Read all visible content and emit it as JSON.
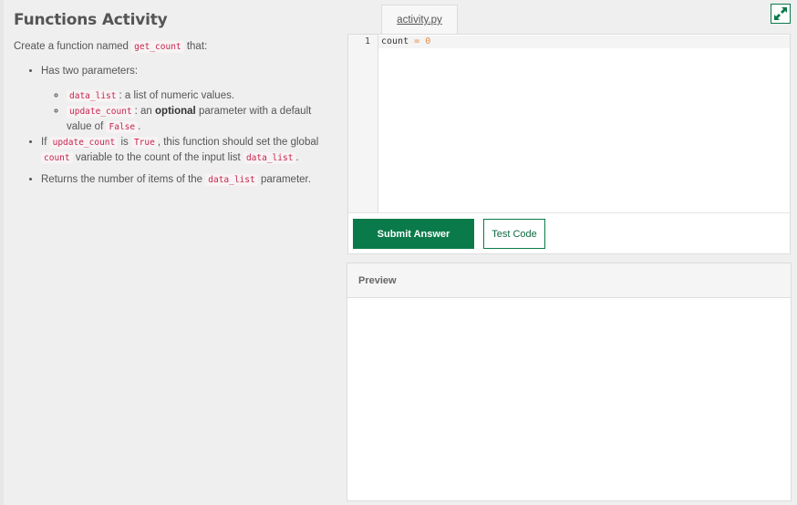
{
  "instructions": {
    "title": "Functions Activity",
    "intro_pre": "Create a function named",
    "intro_code": "get_count",
    "intro_post": "that:",
    "bullet1": {
      "text": "Has two parameters:"
    },
    "sub1": {
      "code": "data_list",
      "text": ": a list of numeric values."
    },
    "sub2": {
      "code": "update_count",
      "text_pre": ": an",
      "bold": "optional",
      "text_mid": "parameter with a default value of",
      "code2": "False",
      "text_post": "."
    },
    "bullet2": {
      "pre": "If",
      "code1": "update_count",
      "mid1": "is",
      "code2": "True",
      "mid2": ", this function should set the global",
      "code3": "count",
      "mid3": "variable to the count of the input list",
      "code4": "data_list",
      "post": "."
    },
    "bullet3": {
      "pre": "Returns the number of items of the",
      "code": "data_list",
      "post": "parameter."
    }
  },
  "editor": {
    "tab_label": "activity.py",
    "line_number": "1",
    "code_ident": "count",
    "code_op": "=",
    "code_value": "0"
  },
  "buttons": {
    "submit": "Submit Answer",
    "test": "Test Code"
  },
  "preview": {
    "header": "Preview"
  },
  "colors": {
    "accent": "#0b7a4a",
    "code_text": "#c7254e"
  },
  "icons": {
    "expand": "expand-arrows-icon"
  }
}
